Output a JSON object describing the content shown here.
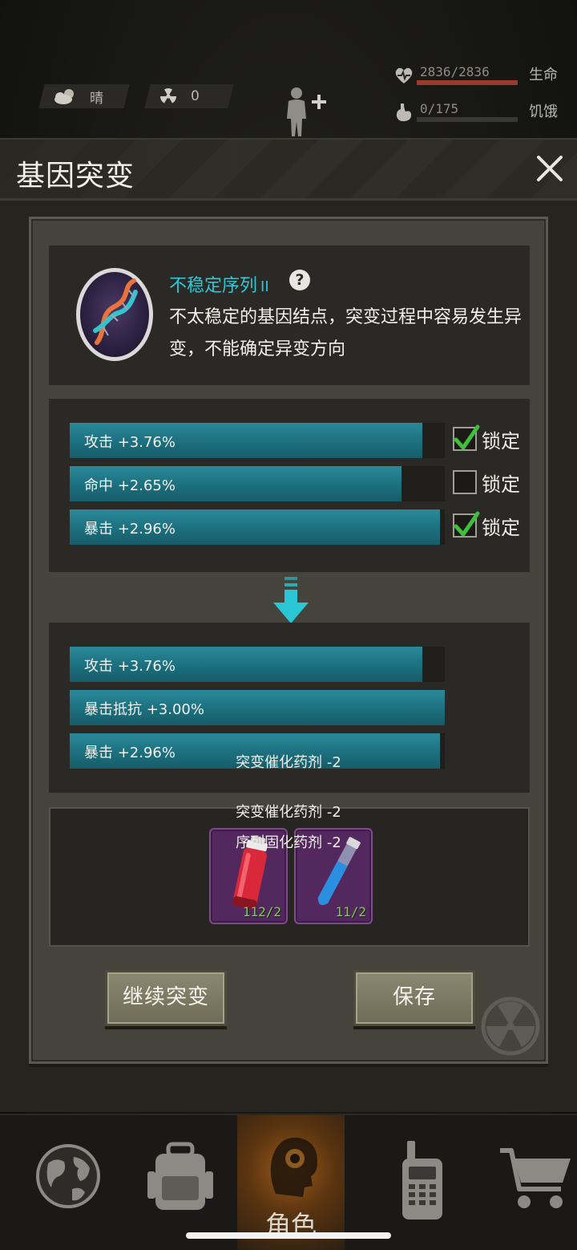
{
  "status": {
    "weather": "晴",
    "radiation": "0",
    "hp_value": "2836/2836",
    "hp_label": "生命",
    "hp_fraction": 1.0,
    "hunger_value": "0/175",
    "hunger_label": "饥饿",
    "hunger_fraction": 0.0
  },
  "dialog": {
    "title": "基因突变",
    "gene": {
      "name": "不稳定序列",
      "level": "II",
      "description": "不太稳定的基因结点，突变过程中容易发生异变，不能确定异变方向"
    },
    "current_attributes": [
      {
        "label": "攻击 +3.76%",
        "fill": 0.94,
        "locked": true,
        "lock_label": "锁定"
      },
      {
        "label": "命中 +2.65%",
        "fill": 0.885,
        "locked": false,
        "lock_label": "锁定"
      },
      {
        "label": "暴击 +2.96%",
        "fill": 0.987,
        "locked": true,
        "lock_label": "锁定"
      }
    ],
    "new_attributes": [
      {
        "label": "攻击 +3.76%",
        "fill": 0.94
      },
      {
        "label": "暴击抵抗 +3.00%",
        "fill": 1.0
      },
      {
        "label": "暴击 +2.96%",
        "fill": 0.987
      }
    ],
    "floating_texts": [
      "突变催化药剂 -2",
      "突变催化药剂 -2",
      "序列固化药剂 -2"
    ],
    "items": [
      {
        "name": "red-vial",
        "count": "112/2",
        "color": "#d8283a"
      },
      {
        "name": "blue-tube",
        "count": "11/2",
        "color": "#2a8fe0"
      }
    ],
    "buttons": {
      "continue": "继续突变",
      "save": "保存"
    }
  },
  "nav": {
    "items": [
      "world",
      "backpack",
      "character",
      "radio",
      "shop"
    ],
    "active_label": "角色"
  },
  "colors": {
    "accent_cyan": "#2ec9d8",
    "bar_teal": "#1c6f7e",
    "item_purple": "#53285e",
    "count_green": "#7dd04a"
  }
}
